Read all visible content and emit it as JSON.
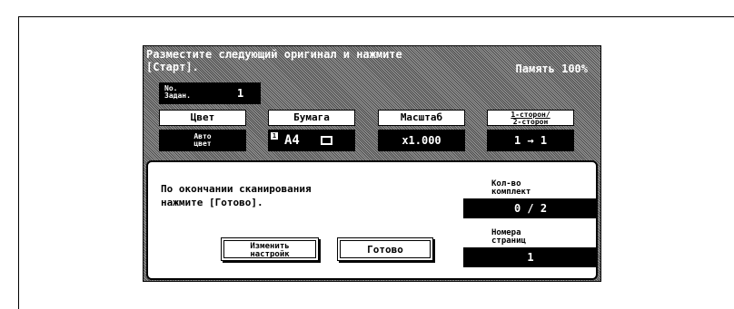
{
  "header": {
    "message_line1": "Разместите следующий оригинал и нажмите",
    "message_line2": "[Старт].",
    "memory": "Память 100%"
  },
  "job": {
    "label_line1": "No.",
    "label_line2": "Задан.",
    "number": "1"
  },
  "settings": [
    {
      "label": "Цвет",
      "value_line1": "Авто",
      "value_line2": "цвет"
    },
    {
      "label": "Бумага",
      "tray": "1",
      "value": "A4"
    },
    {
      "label": "Масштаб",
      "value": "x1.000"
    },
    {
      "label_line1": "1-сторон/",
      "label_line2": "2-сторон",
      "value": "1 → 1"
    }
  ],
  "dialog": {
    "text_line1": "По окончании сканирования",
    "text_line2": "нажмите [Готово].",
    "change_settings_line1": "Изменить",
    "change_settings_line2": "настройк",
    "done_button": "Готово",
    "sets_label_line1": "Кол-во",
    "sets_label_line2": "комплект",
    "sets_value": "0 / 2",
    "pages_label_line1": "Номера",
    "pages_label_line2": "страниц",
    "pages_value": "1"
  }
}
